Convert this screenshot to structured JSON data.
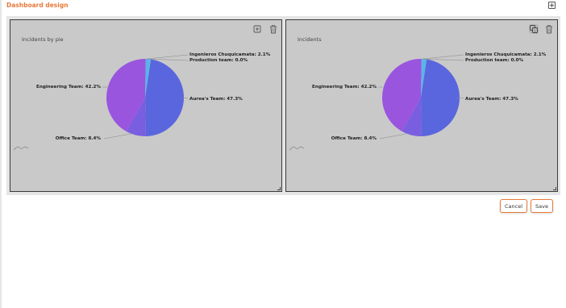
{
  "header": {
    "title": "Dashboard design",
    "add_icon": "plus-square-icon"
  },
  "panels": [
    {
      "title": "Incidents by pie",
      "actions": [
        "plus-square-icon",
        "trash-icon"
      ],
      "chart_data": {
        "type": "pie",
        "slices": [
          {
            "label": "Aurea's Team: 47.3%",
            "value": 47.3,
            "color": "#5a66dd"
          },
          {
            "label": "Office Team: 8.4%",
            "value": 8.4,
            "color": "#7a5ee0"
          },
          {
            "label": "Engineering Team: 42.2%",
            "value": 42.2,
            "color": "#9a55df"
          },
          {
            "label": "Ingenieros Chuquicamata: 2.1%",
            "value": 2.1,
            "color": "#5ab5e8"
          },
          {
            "label": "Production team: 0.0%",
            "value": 0.0,
            "color": "#4a9adc"
          }
        ]
      }
    },
    {
      "title": "Incidents",
      "actions": [
        "copy-icon",
        "trash-icon"
      ],
      "chart_data": {
        "type": "pie",
        "slices": [
          {
            "label": "Aurea's Team: 47.3%",
            "value": 47.3,
            "color": "#5a66dd"
          },
          {
            "label": "Office Team: 8.4%",
            "value": 8.4,
            "color": "#7a5ee0"
          },
          {
            "label": "Engineering Team: 42.2%",
            "value": 42.2,
            "color": "#9a55df"
          },
          {
            "label": "Ingenieros Chuquicamata: 2.1%",
            "value": 2.1,
            "color": "#5ab5e8"
          },
          {
            "label": "Production team: 0.0%",
            "value": 0.0,
            "color": "#4a9adc"
          }
        ]
      }
    }
  ],
  "footer": {
    "cancel_label": "Cancel",
    "save_label": "Save"
  }
}
